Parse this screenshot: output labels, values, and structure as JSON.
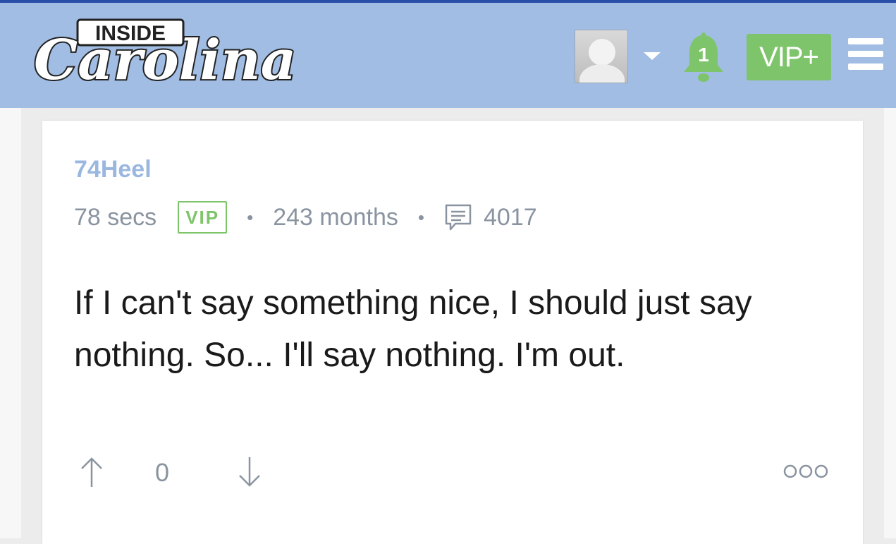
{
  "header": {
    "logo_small": "INSIDE",
    "logo_script": "Carolina",
    "notification_count": "1",
    "vip_button": "VIP+",
    "icons": {
      "avatar": "user-avatar",
      "caret": "chevron-down-icon",
      "bell": "bell-icon",
      "menu": "hamburger-menu-icon"
    },
    "colors": {
      "header_bg": "#a1bde3",
      "accent_green": "#7ec46a",
      "topline": "#2a4fa8"
    }
  },
  "post": {
    "username": "74Heel",
    "time": "78 secs",
    "badge": "VIP",
    "tenure": "243 months",
    "post_count": "4017",
    "body": "If I can't say something nice, I should just say nothing. So... I'll say nothing. I'm out.",
    "votes": "0",
    "icons": {
      "comments": "comment-icon",
      "upvote": "arrow-up-icon",
      "downvote": "arrow-down-icon",
      "more": "more-options-icon"
    },
    "colors": {
      "username": "#9ab7df",
      "meta": "#8a94a0",
      "text": "#1a1a1a"
    }
  }
}
